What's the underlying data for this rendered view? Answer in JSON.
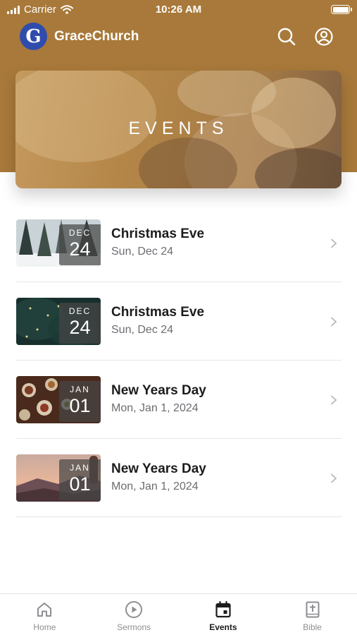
{
  "status_bar": {
    "carrier": "Carrier",
    "time": "10:26 AM"
  },
  "app": {
    "logo_letter": "G",
    "title": "GraceChurch"
  },
  "banner": {
    "title": "EVENTS"
  },
  "events": [
    {
      "month": "DEC",
      "day": "24",
      "title": "Christmas Eve",
      "date": "Sun, Dec 24"
    },
    {
      "month": "DEC",
      "day": "24",
      "title": "Christmas Eve",
      "date": "Sun, Dec 24"
    },
    {
      "month": "JAN",
      "day": "01",
      "title": "New Years Day",
      "date": "Mon, Jan 1, 2024"
    },
    {
      "month": "JAN",
      "day": "01",
      "title": "New Years Day",
      "date": "Mon, Jan 1, 2024"
    }
  ],
  "tabs": [
    {
      "label": "Home",
      "icon": "home-icon"
    },
    {
      "label": "Sermons",
      "icon": "play-circle-icon"
    },
    {
      "label": "Events",
      "icon": "calendar-icon",
      "active": true
    },
    {
      "label": "Bible",
      "icon": "bible-icon"
    }
  ],
  "colors": {
    "brand": "#a8793a",
    "logo": "#2f4cad",
    "active_tab": "#1c1c1e",
    "inactive_tab": "#8e8e93"
  }
}
